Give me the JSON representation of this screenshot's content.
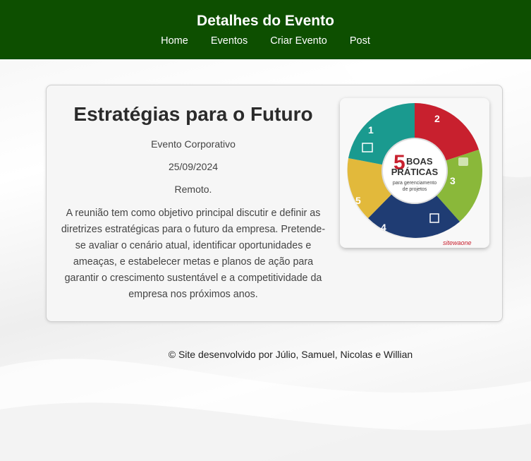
{
  "header": {
    "title": "Detalhes do Evento",
    "nav": [
      "Home",
      "Eventos",
      "Criar Evento",
      "Post"
    ]
  },
  "event": {
    "title": "Estratégias para o Futuro",
    "category": "Evento Corporativo",
    "date": "25/09/2024",
    "location": "Remoto.",
    "description": "A reunião tem como objetivo principal discutir e definir as diretrizes estratégicas para o futuro da empresa. Pretende-se avaliar o cenário atual, identificar oportunidades e ameaças, e estabelecer metas e planos de ação para garantir o crescimento sustentável e a competitividade da empresa nos próximos anos.",
    "image": {
      "center_number": "5",
      "center_line1": "BOAS",
      "center_line2": "PRÁTICAS",
      "center_sub1": "para gerenciamento",
      "center_sub2": "de projetos",
      "segment_numbers": [
        "1",
        "2",
        "3",
        "4",
        "5"
      ],
      "brand": "sitewaone",
      "colors": [
        "#1a9a8f",
        "#c8202e",
        "#8ab83a",
        "#1f3c73",
        "#e2b93b"
      ]
    }
  },
  "footer": {
    "text": "© Site desenvolvido por Júlio, Samuel, Nicolas e Willian"
  }
}
